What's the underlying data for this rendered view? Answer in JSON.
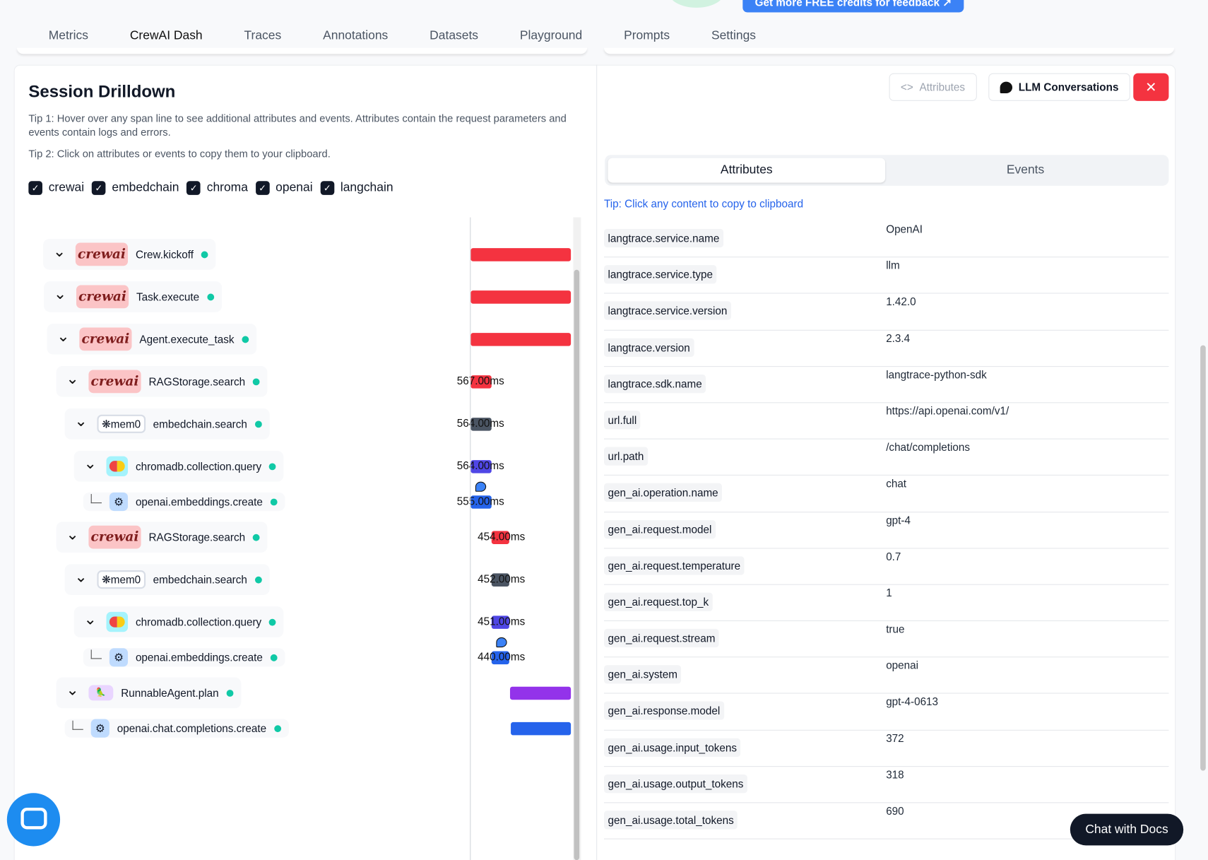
{
  "promo": {
    "label": "Get more FREE credits for feedback ↗"
  },
  "tabs": [
    {
      "label": "Metrics"
    },
    {
      "label": "CrewAI Dash",
      "active": true
    },
    {
      "label": "Traces"
    },
    {
      "label": "Annotations"
    },
    {
      "label": "Datasets"
    },
    {
      "label": "Playground"
    },
    {
      "label": "Prompts"
    },
    {
      "label": "Settings"
    }
  ],
  "drilldown": {
    "title": "Session Drilldown",
    "tip1": "Tip 1: Hover over any span line to see additional attributes and events. Attributes contain the request parameters and events contain logs and errors.",
    "tip2": "Tip 2: Click on attributes or events to copy them to your clipboard.",
    "filters": [
      {
        "label": "crewai",
        "checked": true
      },
      {
        "label": "embedchain",
        "checked": true
      },
      {
        "label": "chroma",
        "checked": true
      },
      {
        "label": "openai",
        "checked": true
      },
      {
        "label": "langchain",
        "checked": true
      }
    ],
    "spans": [
      {
        "name": "Crew.kickoff",
        "vendor": "crewai",
        "logo": "crewai",
        "color": "#f43340",
        "duration": ""
      },
      {
        "name": "Task.execute",
        "vendor": "crewai",
        "logo": "crewai",
        "color": "#f43340",
        "duration": ""
      },
      {
        "name": "Agent.execute_task",
        "vendor": "crewai",
        "logo": "crewai",
        "color": "#f43340",
        "duration": ""
      },
      {
        "name": "RAGStorage.search",
        "vendor": "crewai",
        "logo": "crewai",
        "color": "#f43340",
        "duration": "567.00ms"
      },
      {
        "name": "embedchain.search",
        "vendor": "embedchain",
        "logo": "mem0",
        "color": "#4b5563",
        "duration": "564.00ms"
      },
      {
        "name": "chromadb.collection.query",
        "vendor": "chroma",
        "logo": "chroma",
        "color": "#4f46e5",
        "duration": "564.00ms"
      },
      {
        "name": "openai.embeddings.create",
        "vendor": "openai",
        "logo": "openai",
        "color": "#2563eb",
        "duration": "555.00ms"
      },
      {
        "name": "RAGStorage.search",
        "vendor": "crewai",
        "logo": "crewai",
        "color": "#f43340",
        "duration": "454.00ms"
      },
      {
        "name": "embedchain.search",
        "vendor": "embedchain",
        "logo": "mem0",
        "color": "#4b5563",
        "duration": "452.00ms"
      },
      {
        "name": "chromadb.collection.query",
        "vendor": "chroma",
        "logo": "chroma",
        "color": "#4f46e5",
        "duration": "451.00ms"
      },
      {
        "name": "openai.embeddings.create",
        "vendor": "openai",
        "logo": "openai",
        "color": "#2563eb",
        "duration": "440.00ms"
      },
      {
        "name": "RunnableAgent.plan",
        "vendor": "langchain",
        "logo": "langchain",
        "color": "#9333ea",
        "duration": ""
      },
      {
        "name": "openai.chat.completions.create",
        "vendor": "openai",
        "logo": "openai",
        "color": "#2563eb",
        "duration": ""
      }
    ]
  },
  "detail": {
    "attributes_button": "Attributes",
    "llm_button": "LLM Conversations",
    "close_icon": "x-icon",
    "seg": {
      "attributes": "Attributes",
      "events": "Events",
      "active": "attributes"
    },
    "tip": "Tip: Click any content to copy to clipboard",
    "attributes": [
      {
        "key": "langtrace.service.name",
        "value": "OpenAI"
      },
      {
        "key": "langtrace.service.type",
        "value": "llm"
      },
      {
        "key": "langtrace.service.version",
        "value": "1.42.0"
      },
      {
        "key": "langtrace.version",
        "value": "2.3.4"
      },
      {
        "key": "langtrace.sdk.name",
        "value": "langtrace-python-sdk"
      },
      {
        "key": "url.full",
        "value": "https://api.openai.com/v1/"
      },
      {
        "key": "url.path",
        "value": "/chat/completions"
      },
      {
        "key": "gen_ai.operation.name",
        "value": "chat"
      },
      {
        "key": "gen_ai.request.model",
        "value": "gpt-4"
      },
      {
        "key": "gen_ai.request.temperature",
        "value": "0.7"
      },
      {
        "key": "gen_ai.request.top_k",
        "value": "1"
      },
      {
        "key": "gen_ai.request.stream",
        "value": "true"
      },
      {
        "key": "gen_ai.system",
        "value": "openai"
      },
      {
        "key": "gen_ai.response.model",
        "value": "gpt-4-0613"
      },
      {
        "key": "gen_ai.usage.input_tokens",
        "value": "372"
      },
      {
        "key": "gen_ai.usage.output_tokens",
        "value": "318"
      },
      {
        "key": "gen_ai.usage.total_tokens",
        "value": "690"
      }
    ]
  },
  "chat_docs": "Chat with Docs"
}
